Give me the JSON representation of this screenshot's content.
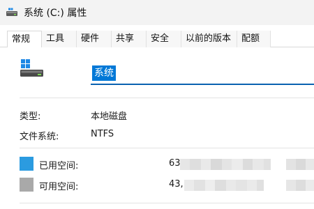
{
  "window": {
    "title": "系统 (C:) 属性",
    "icon": "drive-icon"
  },
  "tabs": [
    {
      "label": "常规",
      "active": true
    },
    {
      "label": "工具",
      "active": false
    },
    {
      "label": "硬件",
      "active": false
    },
    {
      "label": "共享",
      "active": false
    },
    {
      "label": "安全",
      "active": false
    },
    {
      "label": "以前的版本",
      "active": false
    },
    {
      "label": "配额",
      "active": false
    }
  ],
  "general": {
    "drive_icon": "windows-drive-icon",
    "volume_name": "系统",
    "type_label": "类型:",
    "type_value": "本地磁盘",
    "fs_label": "文件系统:",
    "fs_value": "NTFS",
    "used": {
      "label": "已用空间:",
      "value_visible": "63",
      "color": "#2b9be0"
    },
    "free": {
      "label": "可用空间:",
      "value_visible": "43,",
      "color": "#a9a9a9"
    }
  },
  "colors": {
    "accent": "#0078d7",
    "used_space": "#2b9be0",
    "free_space": "#a9a9a9"
  }
}
